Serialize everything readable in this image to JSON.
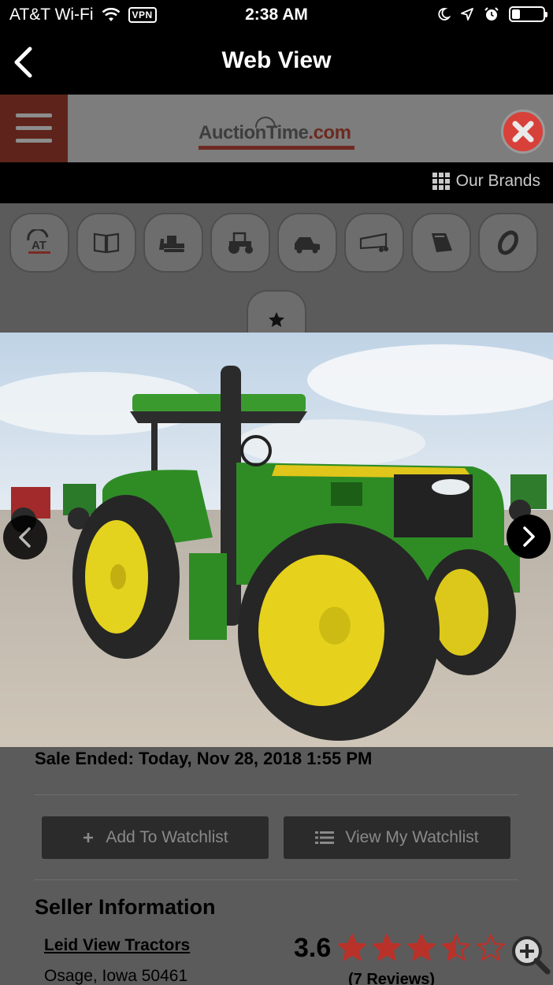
{
  "status_bar": {
    "carrier": "AT&T Wi-Fi",
    "vpn": "VPN",
    "time": "2:38 AM",
    "battery_percent": 25
  },
  "nav": {
    "title": "Web View"
  },
  "site": {
    "logo_text": "AuctionTime",
    "logo_domain": ".com",
    "brands_label": "Our Brands",
    "category_icons": [
      "auctiontime-icon",
      "catalog-book-icon",
      "construction-dozer-icon",
      "farm-tractor-icon",
      "truck-icon",
      "trailer-icon",
      "attachment-bucket-icon",
      "tire-icon"
    ]
  },
  "listing": {
    "sale_ended": "Sale Ended: Today, Nov 28, 2018 1:55 PM",
    "add_watchlist": "Add To Watchlist",
    "view_watchlist": "View My Watchlist"
  },
  "seller": {
    "heading": "Seller Information",
    "name": "Leid View Tractors",
    "location": "Osage, Iowa 50461",
    "rating": "3.6",
    "rating_value": 3.6,
    "reviews": "(7 Reviews)"
  },
  "colors": {
    "accent_red": "#b8322a",
    "tractor_green": "#2e8a26",
    "wheel_yellow": "#e6d21c"
  }
}
